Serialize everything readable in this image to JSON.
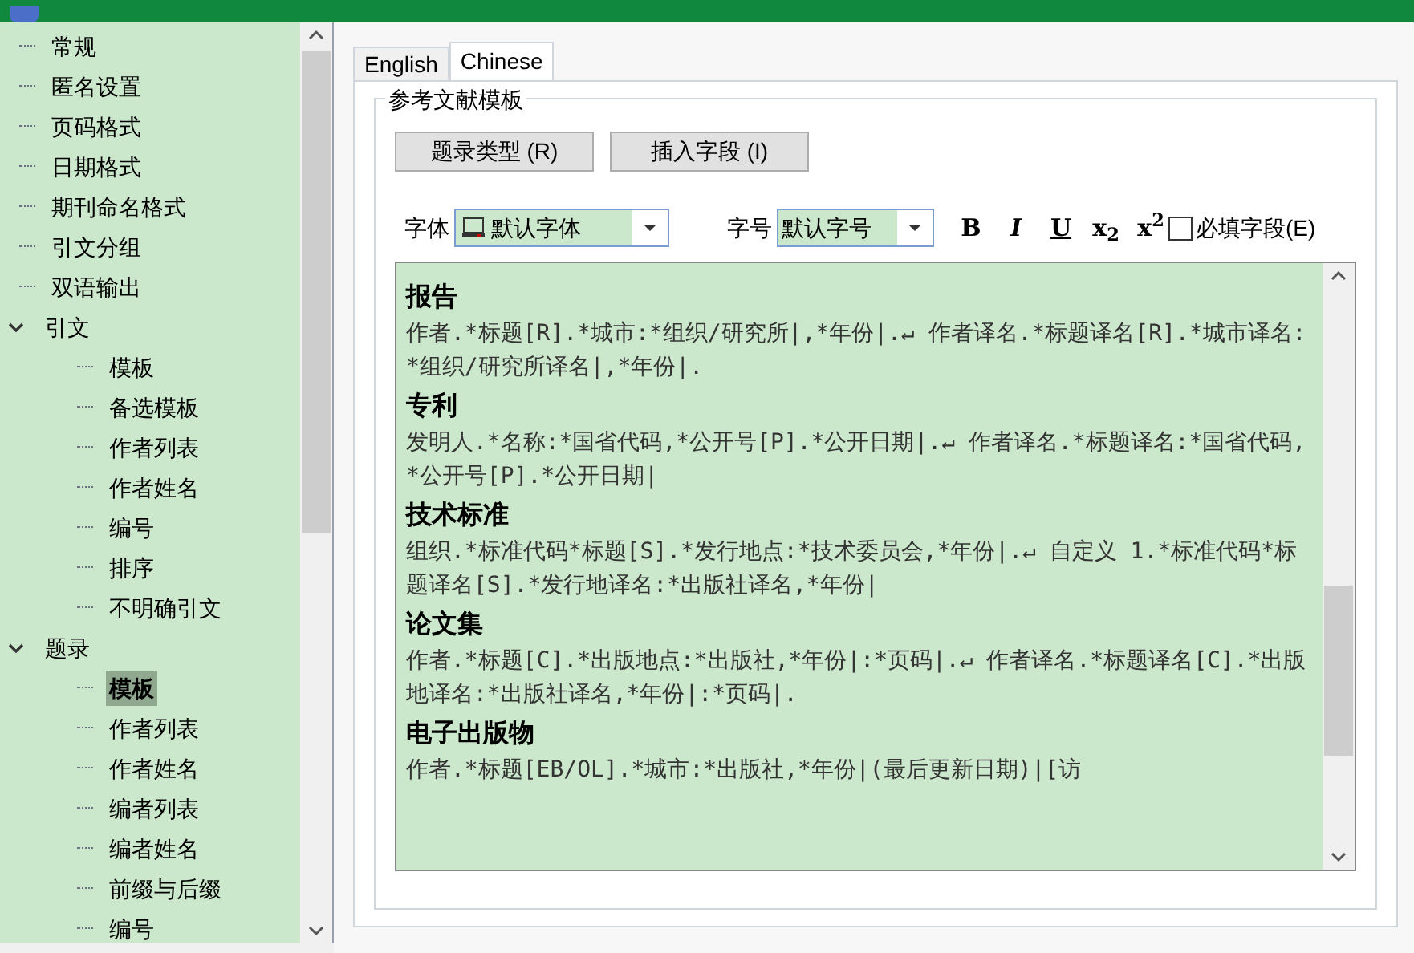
{
  "sidebar": {
    "items": [
      {
        "label": "常规",
        "selected": false
      },
      {
        "label": "匿名设置",
        "selected": false
      },
      {
        "label": "页码格式",
        "selected": false
      },
      {
        "label": "日期格式",
        "selected": false
      },
      {
        "label": "期刊命名格式",
        "selected": false
      },
      {
        "label": "引文分组",
        "selected": false
      },
      {
        "label": "双语输出",
        "selected": false
      },
      {
        "label": "引文",
        "selected": false,
        "expanded": true,
        "children": [
          {
            "label": "模板",
            "selected": false
          },
          {
            "label": "备选模板",
            "selected": false
          },
          {
            "label": "作者列表",
            "selected": false
          },
          {
            "label": "作者姓名",
            "selected": false
          },
          {
            "label": "编号",
            "selected": false
          },
          {
            "label": "排序",
            "selected": false
          },
          {
            "label": "不明确引文",
            "selected": false
          }
        ]
      },
      {
        "label": "题录",
        "selected": false,
        "expanded": true,
        "children": [
          {
            "label": "模板",
            "selected": true
          },
          {
            "label": "作者列表",
            "selected": false
          },
          {
            "label": "作者姓名",
            "selected": false
          },
          {
            "label": "编者列表",
            "selected": false
          },
          {
            "label": "编者姓名",
            "selected": false
          },
          {
            "label": "前缀与后缀",
            "selected": false
          },
          {
            "label": "编号",
            "selected": false
          }
        ]
      }
    ]
  },
  "tabs": [
    {
      "label": "English",
      "selected": false
    },
    {
      "label": "Chinese",
      "selected": true
    }
  ],
  "group": {
    "title": "参考文献模板",
    "buttons": [
      "题录类型 (R)",
      "插入字段 (I)"
    ],
    "font": {
      "label": "字体",
      "value": "默认字体"
    },
    "size": {
      "label": "字号",
      "value": "默认字号"
    },
    "format_buttons": [
      "B",
      "I",
      "U",
      "x$_{2}$",
      "x$^{2}$"
    ],
    "required": {
      "label": "必填字段(E)",
      "checked": false
    },
    "templates": [
      {
        "title": "报告",
        "body": "作者.*标题[R].*城市:*组织/研究所|,*年份|.↵ 作者译名.*标题译名[R].*城市译名:*组织/研究所译名|,*年份|."
      },
      {
        "title": "专利",
        "body": "发明人.*名称:*国省代码,*公开号[P].*公开日期|.↵ 作者译名.*标题译名:*国省代码,*公开号[P].*公开日期|"
      },
      {
        "title": "技术标准",
        "body": "组织.*标准代码*标题[S].*发行地点:*技术委员会,*年份|.↵ 自定义 1.*标准代码*标题译名[S].*发行地译名:*出版社译名,*年份|"
      },
      {
        "title": "论文集",
        "body": "作者.*标题[C].*出版地点:*出版社,*年份|:*页码|.↵ 作者译名.*标题译名[C].*出版地译名:*出版社译名,*年份|:*页码|."
      },
      {
        "title": "电子出版物",
        "body": "作者.*标题[EB/OL].*城市:*出版社,*年份|(最后更新日期)|[访"
      }
    ]
  }
}
